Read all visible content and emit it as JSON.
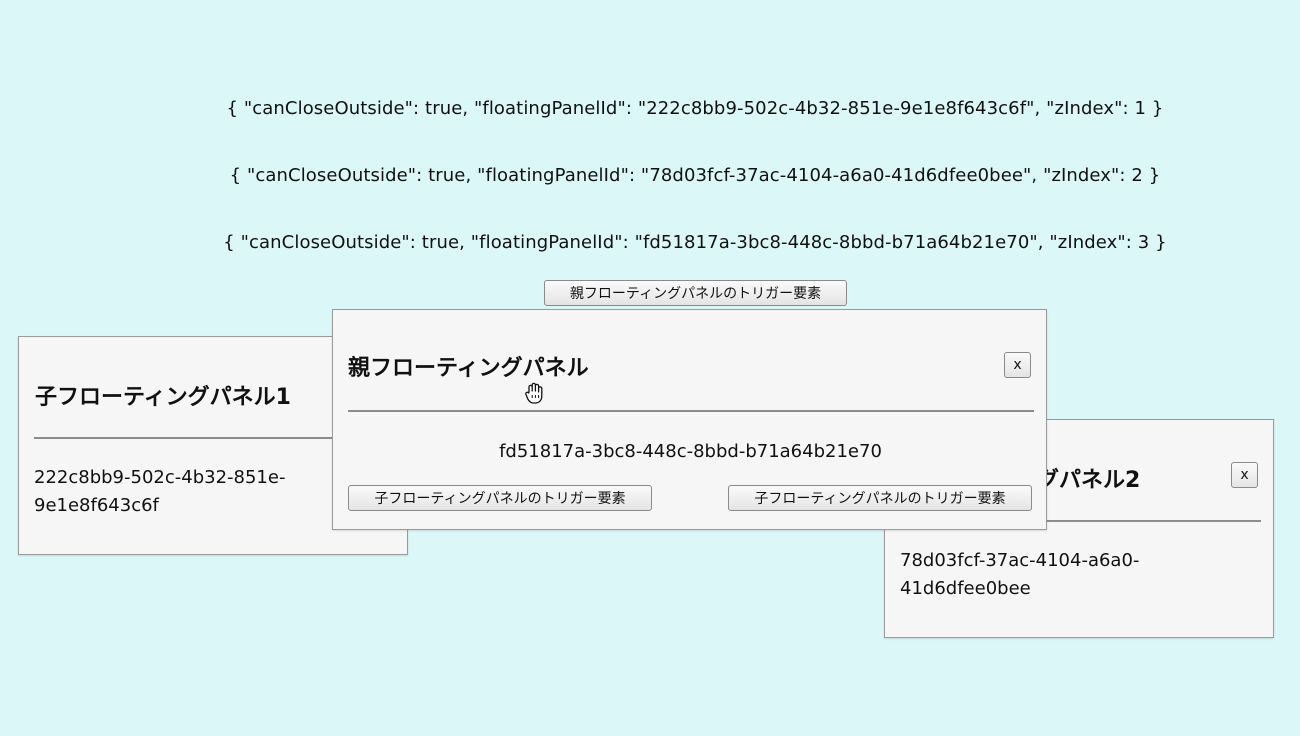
{
  "json_lines": [
    "{ \"canCloseOutside\": true, \"floatingPanelId\": \"222c8bb9-502c-4b32-851e-9e1e8f643c6f\", \"zIndex\": 1 }",
    "{ \"canCloseOutside\": true, \"floatingPanelId\": \"78d03fcf-37ac-4104-a6a0-41d6dfee0bee\", \"zIndex\": 2 }",
    "{ \"canCloseOutside\": true, \"floatingPanelId\": \"fd51817a-3bc8-448c-8bbd-b71a64b21e70\", \"zIndex\": 3 }"
  ],
  "parent_trigger_label": "親フローティングパネルのトリガー要素",
  "child_panel_1": {
    "title": "子フローティングパネル1",
    "id_line_1": "222c8bb9-502c-4b32-851e-",
    "id_line_2": "9e1e8f643c6f"
  },
  "child_panel_2": {
    "title_visible": "ングパネル2",
    "close_label": "x",
    "id_line_1": "78d03fcf-37ac-4104-a6a0-",
    "id_line_2": "41d6dfee0bee"
  },
  "parent_panel": {
    "title": "親フローティングパネル",
    "close_label": "x",
    "id": "fd51817a-3bc8-448c-8bbd-b71a64b21e70",
    "child_trigger_1_label": "子フローティングパネルのトリガー要素",
    "child_trigger_2_label": "子フローティングパネルのトリガー要素"
  },
  "cursor_icon": "grab-hand-icon"
}
